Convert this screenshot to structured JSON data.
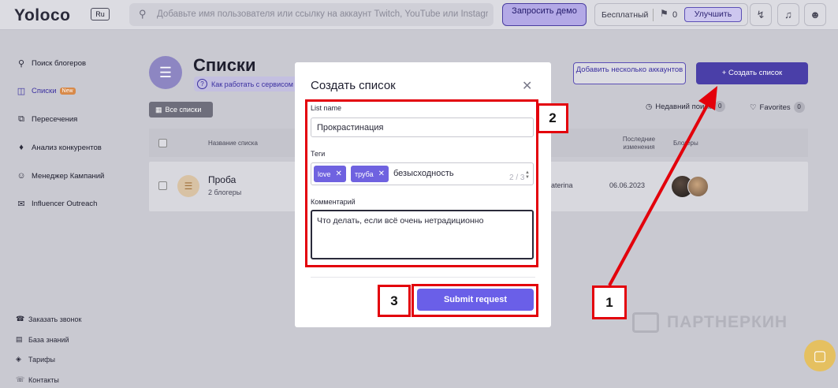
{
  "topbar": {
    "logo": "Yoloco",
    "lang": "Ru",
    "search_placeholder": "Добавьте имя пользователя или ссылку на аккаунт Twitch, YouTube или Instagram",
    "demo_label": "Запросить демо",
    "plan_name": "Бесплатный",
    "plan_count": "0",
    "upgrade_label": "Улучшить"
  },
  "sidebar": {
    "items": [
      {
        "label": "Поиск блогеров",
        "icon": "search-icon"
      },
      {
        "label": "Списки",
        "icon": "lists-icon",
        "badge": "New"
      },
      {
        "label": "Пересечения",
        "icon": "intersections-icon"
      },
      {
        "label": "Анализ конкурентов",
        "icon": "tag-icon"
      },
      {
        "label": "Менеджер Кампаний",
        "icon": "person-icon"
      },
      {
        "label": "Influencer Outreach",
        "icon": "chat-icon"
      }
    ],
    "bottom": [
      {
        "label": "Заказать звонок",
        "icon": "phone-icon"
      },
      {
        "label": "База знаний",
        "icon": "book-icon"
      },
      {
        "label": "Тарифы",
        "icon": "tariff-icon"
      },
      {
        "label": "Контакты",
        "icon": "contacts-icon"
      }
    ]
  },
  "main": {
    "title": "Списки",
    "howto": "Как работать с сервисом",
    "all_lists": "Все списки",
    "add_accounts": "Добавить несколько аккаунтов",
    "create_list": "+ Создать список",
    "recent_label": "Недавний поиск",
    "recent_count": "0",
    "favorites_label": "Favorites",
    "favorites_count": "0",
    "table": {
      "col_name": "Название списка",
      "col_changes": "Последние изменения",
      "col_bloggers": "Блогеры",
      "rows": [
        {
          "name": "Проба",
          "count": "2 блогеры",
          "owner": "aterina",
          "date": "06.06.2023"
        }
      ]
    }
  },
  "modal": {
    "title": "Создать список",
    "name_label": "List name",
    "name_value": "Прокрастинация",
    "tags_label": "Теги",
    "tags": [
      "love",
      "труба"
    ],
    "tag_input": "безысходность",
    "tag_counter": "2 / 3",
    "comment_label": "Комментарий",
    "comment_value": "Что делать, если всё очень нетрадиционно",
    "submit_label": "Submit request"
  },
  "annotations": {
    "step1": "1",
    "step2": "2",
    "step3": "3",
    "color": "#e3000b"
  },
  "watermark": "ПАРТНЕРКИН"
}
